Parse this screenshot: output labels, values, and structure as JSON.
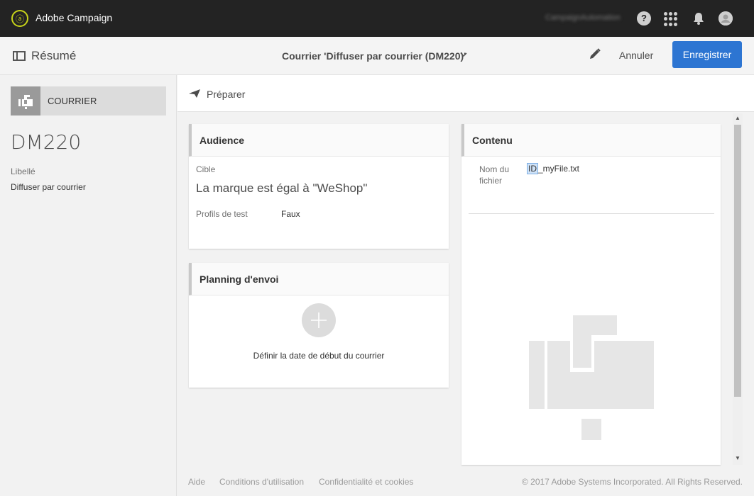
{
  "app": {
    "title": "Adobe Campaign",
    "user": "CampaignAutomation"
  },
  "header": {
    "resume_label": "Résumé",
    "delivery_title": "Courrier 'Diffuser par courrier (DM220)'",
    "cancel_label": "Annuler",
    "save_label": "Enregistrer"
  },
  "left": {
    "channel": "COURRIER",
    "code": "DM220",
    "libelle_title": "Libellé",
    "libelle_value": "Diffuser par courrier"
  },
  "toolbar": {
    "prepare_label": "Préparer"
  },
  "audience": {
    "title": "Audience",
    "cible_label": "Cible",
    "cible_value": "La marque est égal à \"WeShop\"",
    "profils_label": "Profils de test",
    "profils_value": "Faux"
  },
  "planning": {
    "title": "Planning d'envoi",
    "text": "Définir la date de début du courrier"
  },
  "contenu": {
    "title": "Contenu",
    "file_label": "Nom du fichier",
    "file_id": "ID",
    "file_rest": "_myFile.txt"
  },
  "footer": {
    "aide": "Aide",
    "conditions": "Conditions d'utilisation",
    "confidentialite": "Confidentialité et cookies",
    "copyright": "© 2017 Adobe Systems Incorporated. All Rights Reserved."
  },
  "colors": {
    "primary": "#2d75d2",
    "topbar": "#232323",
    "logo_accent": "#c8d419"
  }
}
